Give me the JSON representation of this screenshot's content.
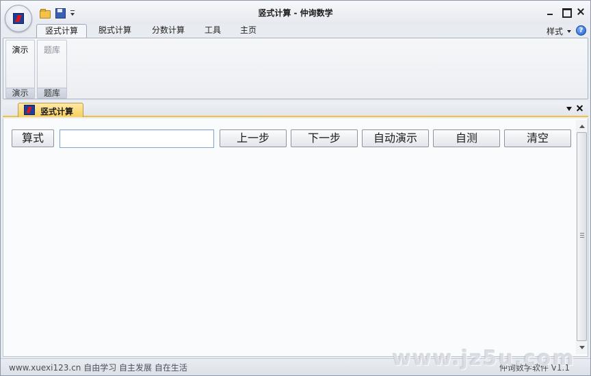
{
  "window": {
    "title": "竖式计算 - 仲询数学"
  },
  "ribbon": {
    "tabs": [
      {
        "label": "竖式计算",
        "active": true
      },
      {
        "label": "脱式计算",
        "active": false
      },
      {
        "label": "分数计算",
        "active": false
      },
      {
        "label": "工具",
        "active": false
      },
      {
        "label": "主页",
        "active": false
      }
    ],
    "style_menu": "样式",
    "help": "?",
    "groups": [
      {
        "button": "演示",
        "label": "演示",
        "enabled": true
      },
      {
        "button": "题库",
        "label": "题库",
        "enabled": false
      }
    ]
  },
  "document": {
    "tab_title": "竖式计算"
  },
  "toolbar": {
    "formula_label": "算式",
    "formula_value": "",
    "prev_step": "上一步",
    "next_step": "下一步",
    "auto_demo": "自动演示",
    "self_test": "自测",
    "clear": "清空"
  },
  "status": {
    "left": "www.xuexi123.cn 自由学习 自主发展 自在生活",
    "right": "仲询数学软件 V1.1"
  },
  "watermark": "www.jz5u.com",
  "colors": {
    "doc_tab_accent": "#f0c040",
    "input_border": "#7ea4d4"
  }
}
